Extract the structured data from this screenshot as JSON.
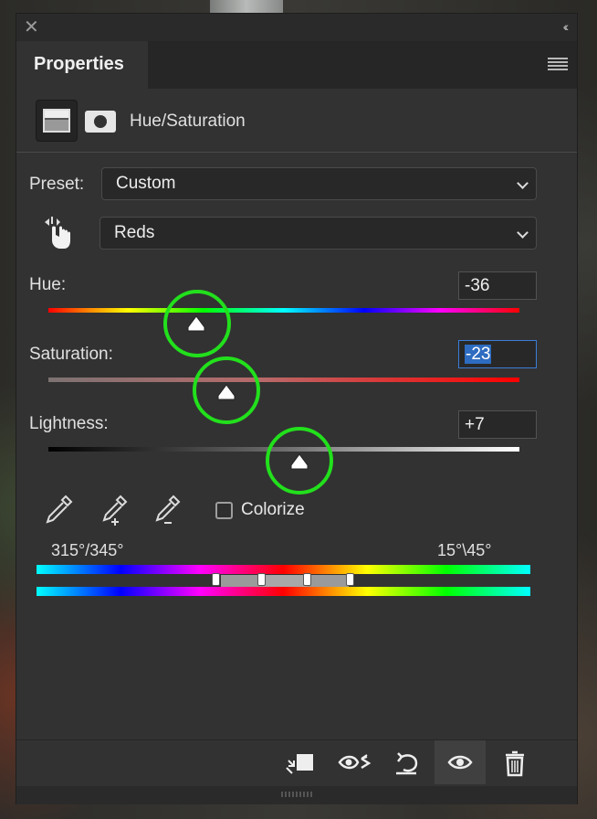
{
  "panel": {
    "tab_title": "Properties",
    "adjustment_title": "Hue/Saturation"
  },
  "preset": {
    "label": "Preset:",
    "value": "Custom"
  },
  "channel": {
    "value": "Reds"
  },
  "hue": {
    "label": "Hue:",
    "value": "-36",
    "level": -36
  },
  "saturation": {
    "label": "Saturation:",
    "value": "-23",
    "level": -23
  },
  "lightness": {
    "label": "Lightness:",
    "value": "+7",
    "level": 7
  },
  "colorize": {
    "label": "Colorize",
    "checked": false
  },
  "range": {
    "left_label": "315°/345°",
    "right_label": "15°\\45°"
  },
  "icons": {
    "close": "close-icon",
    "collapse": "double-chevron-left-icon",
    "menu": "panel-menu-icon",
    "adjustment": "hue-saturation-icon",
    "mask": "layer-mask-icon",
    "target_adjust": "targeted-adjustment-hand-icon",
    "eyedropper": "eyedropper-icon",
    "eyedropper_add": "eyedropper-add-icon",
    "eyedropper_subtract": "eyedropper-subtract-icon",
    "clip": "clip-to-layer-icon",
    "view_previous": "view-previous-state-icon",
    "reset": "reset-icon",
    "visibility": "visibility-eye-icon",
    "delete": "trash-icon"
  },
  "colors": {
    "highlight_circle": "#22e01c",
    "active_field": "#3b7dd8"
  }
}
